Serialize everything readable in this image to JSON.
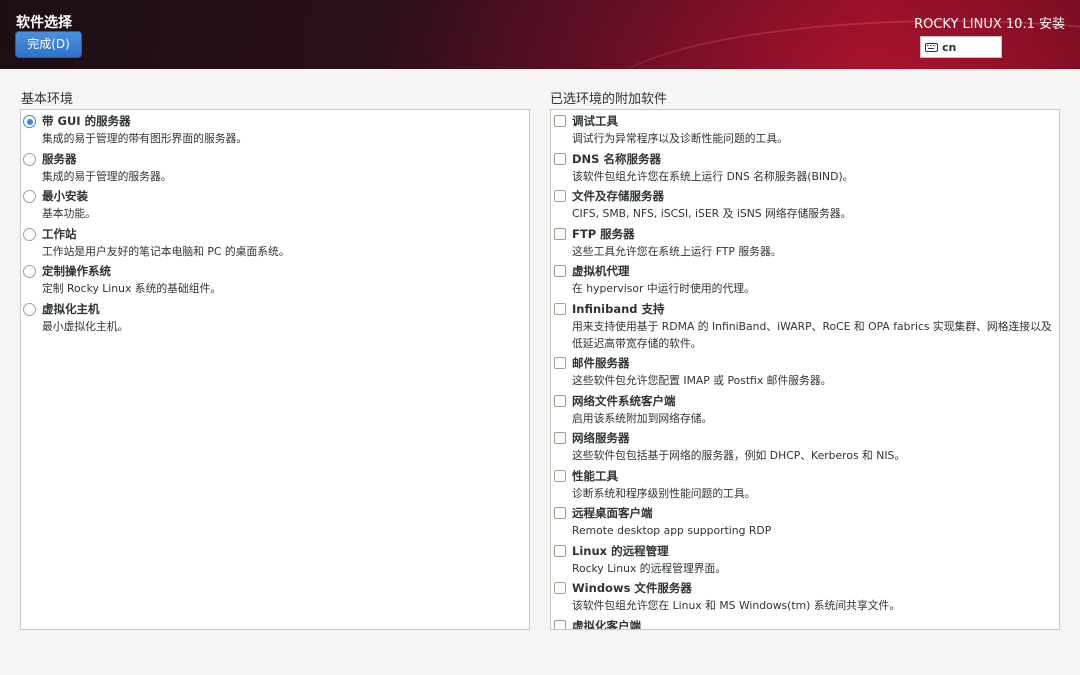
{
  "header": {
    "page_title": "软件选择",
    "done_label": "完成(D)",
    "product_title": "ROCKY LINUX 10.1 安装",
    "keyboard_layout": "cn",
    "colors": {
      "accent": "#3584e4",
      "header_dark": "#1c0f14",
      "header_red": "#8a1028"
    }
  },
  "base_environment": {
    "label": "基本环境",
    "items": [
      {
        "title": "带 GUI 的服务器",
        "desc": "集成的易于管理的带有图形界面的服务器。",
        "selected": true
      },
      {
        "title": "服务器",
        "desc": "集成的易于管理的服务器。",
        "selected": false
      },
      {
        "title": "最小安装",
        "desc": "基本功能。",
        "selected": false
      },
      {
        "title": "工作站",
        "desc": "工作站是用户友好的笔记本电脑和 PC 的桌面系统。",
        "selected": false
      },
      {
        "title": "定制操作系统",
        "desc": "定制 Rocky Linux 系统的基础组件。",
        "selected": false
      },
      {
        "title": "虚拟化主机",
        "desc": "最小虚拟化主机。",
        "selected": false
      }
    ]
  },
  "addons": {
    "label": "已选环境的附加软件",
    "items": [
      {
        "title": "调试工具",
        "desc": "调试行为异常程序以及诊断性能问题的工具。",
        "checked": false
      },
      {
        "title": "DNS 名称服务器",
        "desc": "该软件包组允许您在系统上运行 DNS 名称服务器(BIND)。",
        "checked": false
      },
      {
        "title": "文件及存储服务器",
        "desc": "CIFS, SMB, NFS, iSCSI, iSER 及 iSNS 网络存储服务器。",
        "checked": false
      },
      {
        "title": "FTP 服务器",
        "desc": "这些工具允许您在系统上运行 FTP 服务器。",
        "checked": false
      },
      {
        "title": "虚拟机代理",
        "desc": "在 hypervisor 中运行时使用的代理。",
        "checked": false
      },
      {
        "title": "Infiniband 支持",
        "desc": "用来支持使用基于 RDMA 的 InfiniBand、iWARP、RoCE 和 OPA fabrics 实现集群、网格连接以及低延迟高带宽存储的软件。",
        "checked": false
      },
      {
        "title": "邮件服务器",
        "desc": "这些软件包允许您配置 IMAP 或 Postfix 邮件服务器。",
        "checked": false
      },
      {
        "title": "网络文件系统客户端",
        "desc": "启用该系统附加到网络存储。",
        "checked": false
      },
      {
        "title": "网络服务器",
        "desc": "这些软件包包括基于网络的服务器，例如 DHCP、Kerberos 和 NIS。",
        "checked": false
      },
      {
        "title": "性能工具",
        "desc": "诊断系统和程序级别性能问题的工具。",
        "checked": false
      },
      {
        "title": "远程桌面客户端",
        "desc": "Remote desktop app supporting RDP",
        "checked": false
      },
      {
        "title": "Linux 的远程管理",
        "desc": "Rocky Linux 的远程管理界面。",
        "checked": false
      },
      {
        "title": "Windows 文件服务器",
        "desc": "该软件包组允许您在 Linux 和 MS Windows(tm) 系统间共享文件。",
        "checked": false
      },
      {
        "title": "虚拟化客户端",
        "desc": "",
        "checked": false
      }
    ]
  }
}
